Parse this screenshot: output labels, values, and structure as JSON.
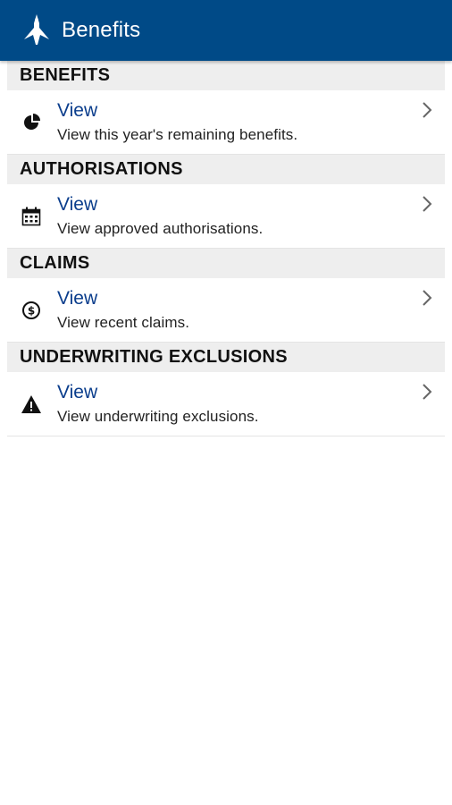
{
  "appbar": {
    "title": "Benefits",
    "logo_icon": "eagle-logo-icon",
    "color": "#004a87"
  },
  "sections": [
    {
      "header": "BENEFITS",
      "link": "View",
      "description": "View this year's remaining benefits.",
      "icon": "pie-chart-icon"
    },
    {
      "header": "AUTHORISATIONS",
      "link": "View",
      "description": "View approved authorisations.",
      "icon": "calendar-icon"
    },
    {
      "header": "CLAIMS",
      "link": "View",
      "description": "View recent claims.",
      "icon": "dollar-coin-icon"
    },
    {
      "header": "UNDERWRITING EXCLUSIONS",
      "link": "View",
      "description": "View underwriting exclusions.",
      "icon": "warning-icon"
    }
  ],
  "colors": {
    "link": "#0a3d8c",
    "section_bg": "#eeeeee"
  }
}
